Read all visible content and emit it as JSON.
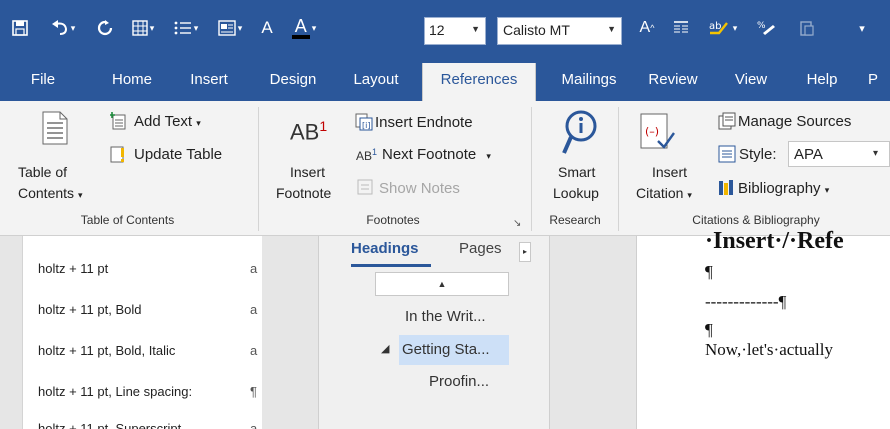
{
  "toolbar": {
    "font_label": "A",
    "font_color_label": "A",
    "font_size": "12",
    "font_name": "Calisto MT",
    "grow_font_label": "A",
    "accent_color": "#2b579a"
  },
  "tabs": [
    {
      "label": "File"
    },
    {
      "label": "Home"
    },
    {
      "label": "Insert"
    },
    {
      "label": "Design"
    },
    {
      "label": "Layout"
    },
    {
      "label": "References"
    },
    {
      "label": "Mailings"
    },
    {
      "label": "Review"
    },
    {
      "label": "View"
    },
    {
      "label": "Help"
    },
    {
      "label": "P"
    }
  ],
  "ribbon": {
    "toc": {
      "line1": "Table of",
      "line2": "Contents",
      "add_text": "Add Text",
      "update_table": "Update Table",
      "group_label": "Table of Contents"
    },
    "footnotes": {
      "insert_line1": "Insert",
      "insert_line2": "Footnote",
      "icon_text": "AB",
      "icon_sup": "1",
      "insert_endnote": "Insert Endnote",
      "next_footnote": "Next Footnote",
      "show_notes": "Show Notes",
      "group_label": "Footnotes"
    },
    "research": {
      "line1": "Smart",
      "line2": "Lookup",
      "group_label": "Research"
    },
    "citations": {
      "insert_line1": "Insert",
      "insert_line2": "Citation",
      "manage_sources": "Manage Sources",
      "style_label": "Style:",
      "style_value": "APA",
      "bibliography": "Bibliography",
      "group_label": "Citations & Bibliography"
    }
  },
  "styles_pane": {
    "items": [
      {
        "name": "holtz + 11 pt",
        "mark": "a"
      },
      {
        "name": "holtz + 11 pt, Bold",
        "mark": "a"
      },
      {
        "name": "holtz + 11 pt, Bold, Italic",
        "mark": "a"
      },
      {
        "name": "holtz + 11 pt, Line spacing:",
        "mark": "¶"
      },
      {
        "name": "holtz + 11 pt, Superscript",
        "mark": "a"
      }
    ]
  },
  "nav_pane": {
    "tab_headings": "Headings",
    "tab_pages": "Pages",
    "items": [
      {
        "label": "In the Writ..."
      },
      {
        "label": "Getting Sta...",
        "prefix": "◢"
      },
      {
        "label": "Proofin..."
      }
    ]
  },
  "document": {
    "lines": [
      {
        "text": "·Insert·/·Refe"
      },
      {
        "text": "¶"
      },
      {
        "text": "-------------¶"
      },
      {
        "text": "¶"
      },
      {
        "text": "Now,·let's·actually"
      }
    ]
  }
}
